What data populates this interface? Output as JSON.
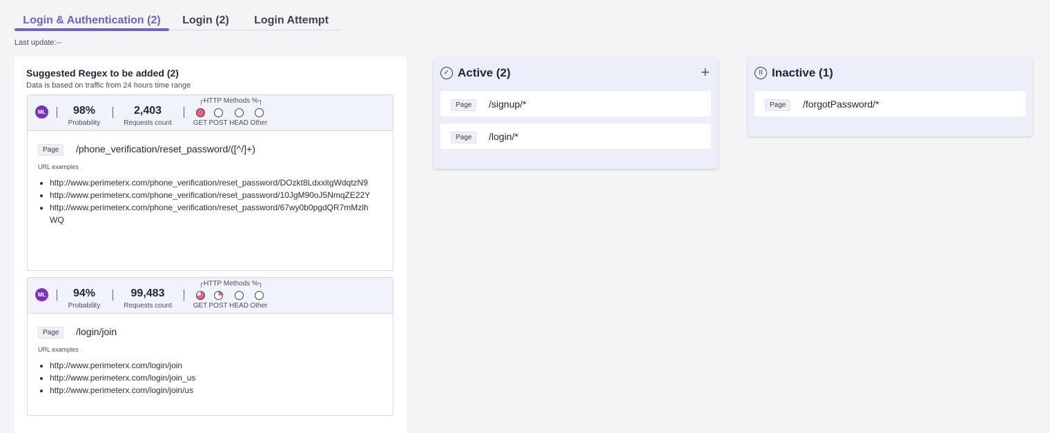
{
  "tabs": [
    {
      "label": "Login & Authentication (2)"
    },
    {
      "label": "Login (2)"
    },
    {
      "label": "Login Attempt"
    }
  ],
  "last_update": "Last update:--",
  "suggested": {
    "title": "Suggested Regex to be added (2)",
    "subtitle": "Data is based on traffic from 24 hours time range",
    "methods_title": "┌HTTP Methods %┐",
    "cards": [
      {
        "badge": "ML",
        "probability": "98%",
        "probability_label": "Probability",
        "requests": "2,403",
        "requests_label": "Requests count",
        "methods": [
          {
            "label": "GET",
            "fill_percent": 100
          },
          {
            "label": "POST",
            "fill_percent": 0
          },
          {
            "label": "HEAD",
            "fill_percent": 0
          },
          {
            "label": "Other",
            "fill_percent": 0
          }
        ],
        "tag": "Page",
        "regex": "/phone_verification/reset_password/([^/]+)",
        "url_examples_label": "URL examples",
        "urls": [
          "http://www.perimeterx.com/phone_verification/reset_password/DOzkt8LdxxitgWdqtzN9",
          "http://www.perimeterx.com/phone_verification/reset_password/10JgM90oJ5NmqZE22Y",
          "http://www.perimeterx.com/phone_verification/reset_password/67wy0b0pgdQR7mMzlhWQ"
        ]
      },
      {
        "badge": "ML",
        "probability": "94%",
        "probability_label": "Probability",
        "requests": "99,483",
        "requests_label": "Requests count",
        "methods": [
          {
            "label": "GET",
            "fill_percent": 75
          },
          {
            "label": "POST",
            "fill_percent": 25
          },
          {
            "label": "HEAD",
            "fill_percent": 0
          },
          {
            "label": "Other",
            "fill_percent": 0
          }
        ],
        "tag": "Page",
        "regex": "/login/join",
        "url_examples_label": "URL examples",
        "urls": [
          "http://www.perimeterx.com/login/join",
          "http://www.perimeterx.com/login/join_us",
          "http://www.perimeterx.com/login/join/us"
        ]
      }
    ]
  },
  "active": {
    "title": "Active (2)",
    "icon": "check-circle-icon",
    "add_label": "+",
    "rows": [
      {
        "tag": "Page",
        "path": "/signup/*"
      },
      {
        "tag": "Page",
        "path": "/login/*"
      }
    ]
  },
  "inactive": {
    "title": "Inactive (1)",
    "icon": "pause-circle-icon",
    "rows": [
      {
        "tag": "Page",
        "path": "/forgotPassword/*"
      }
    ]
  },
  "colors": {
    "accent": "#6a63c8",
    "ml_badge": "#7b2fbe",
    "pie_fill": "#e8637a"
  }
}
